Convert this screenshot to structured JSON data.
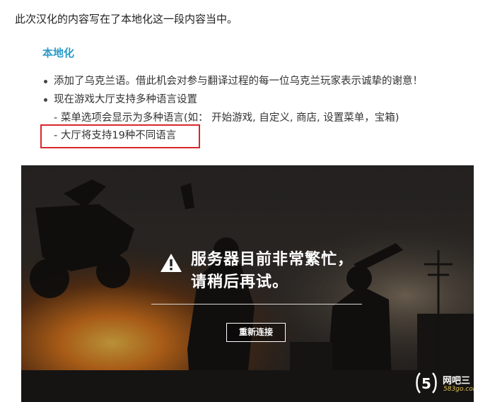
{
  "article": {
    "intro": "此次汉化的内容写在了本地化这一段内容当中。",
    "section_heading": "本地化",
    "bullets": [
      {
        "text": "添加了乌克兰语。借此机会对参与翻译过程的每一位乌克兰玩家表示诚挚的谢意！"
      },
      {
        "text": "现在游戏大厅支持多种语言设置"
      }
    ],
    "sublines": [
      "- 菜单选项会显示为多种语言(如：  开始游戏, 自定义, 商店, 设置菜单，宝箱)",
      "- 大厅将支持19种不同语言"
    ]
  },
  "game_screen": {
    "error_message_line1": "服务器目前非常繁忙，",
    "error_message_line2": "请稍后再试。",
    "reconnect_label": "重新连接",
    "warning_icon": "warning-triangle-icon"
  },
  "watermark": {
    "logo": "5",
    "text": "网吧三",
    "url": "583go.com"
  },
  "colors": {
    "heading": "#2b9ac8",
    "highlight_border": "#d9262c",
    "watermark_url": "#e0c050"
  }
}
